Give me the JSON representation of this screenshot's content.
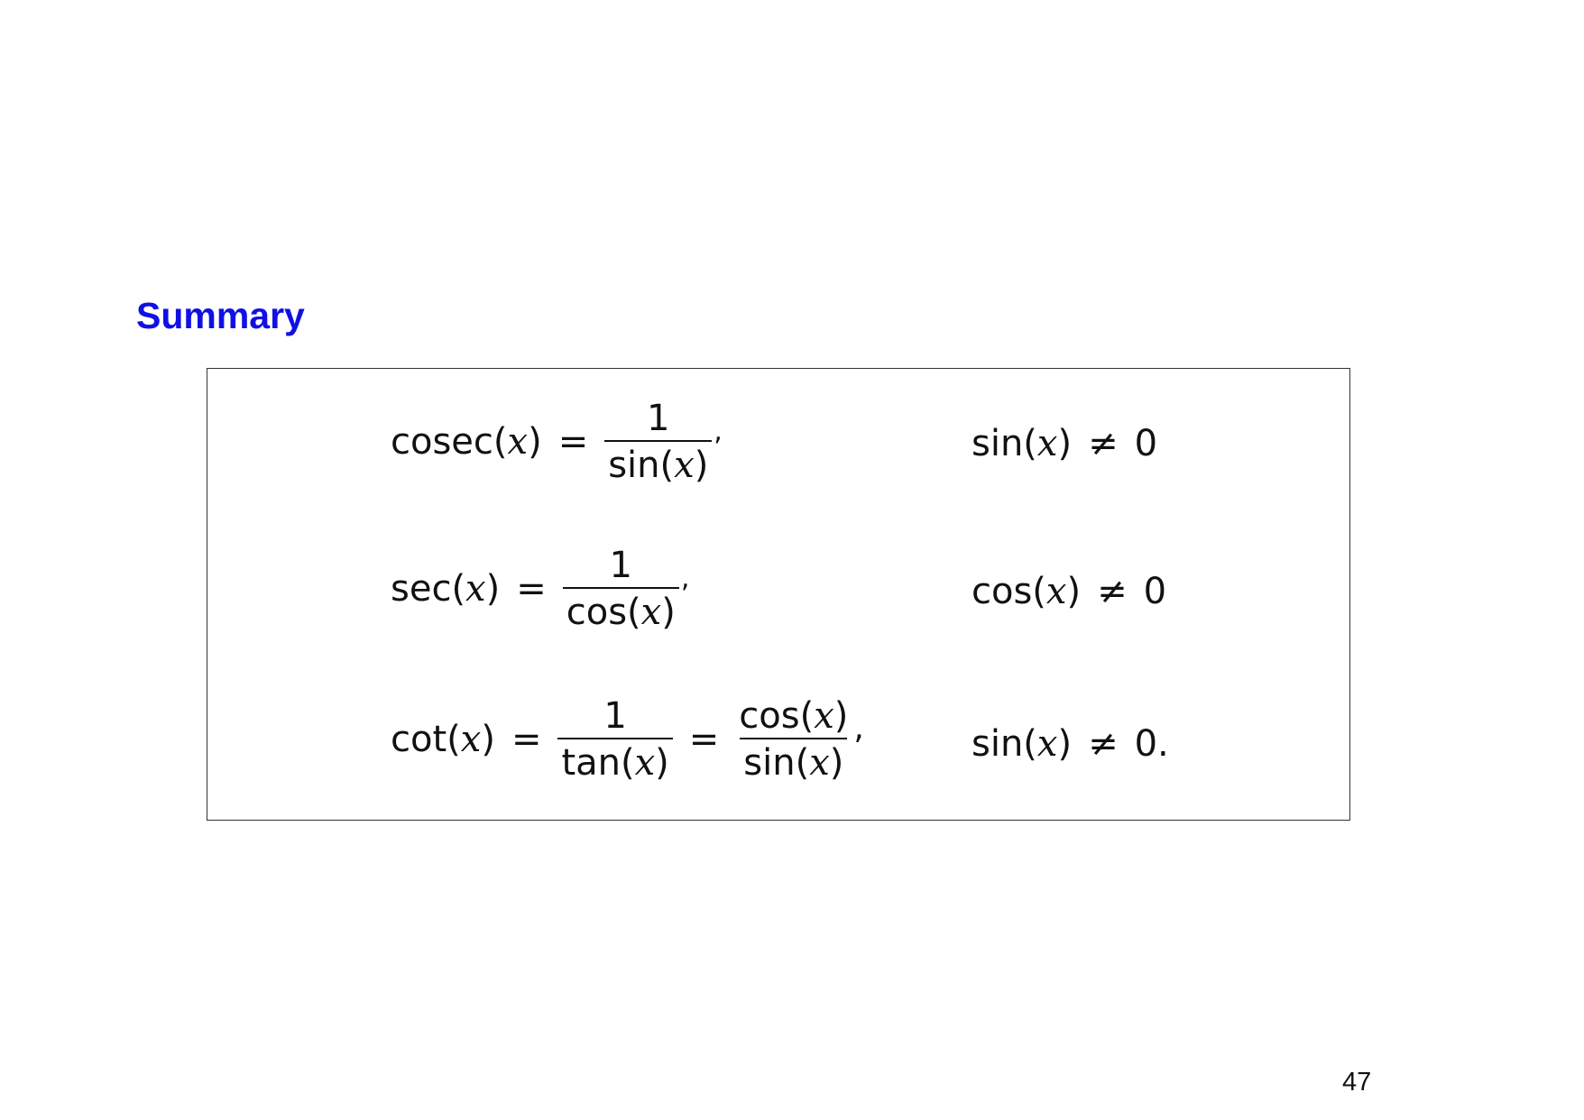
{
  "slide": {
    "title": "Summary",
    "title_color": "#1010e6",
    "page_number": "47"
  },
  "formulas": {
    "cosec": {
      "lhs": "cosec(",
      "var": "x",
      "close": ")",
      "equals": "=",
      "numerator": "1",
      "den_fn": "sin(",
      "den_var": "x",
      "den_close": ")",
      "comma": ",",
      "condition_fn": "sin(",
      "condition_var": "x",
      "condition_close": ")",
      "condition_op": "≠",
      "condition_value": "0"
    },
    "sec": {
      "lhs": "sec(",
      "var": "x",
      "close": ")",
      "equals": "=",
      "numerator": "1",
      "den_fn": "cos(",
      "den_var": "x",
      "den_close": ")",
      "comma": ",",
      "condition_fn": "cos(",
      "condition_var": "x",
      "condition_close": ")",
      "condition_op": "≠",
      "condition_value": "0"
    },
    "cot": {
      "lhs": "cot(",
      "var": "x",
      "close": ")",
      "equals": "=",
      "numerator": "1",
      "den_fn": "tan(",
      "den_var": "x",
      "den_close": ")",
      "equals2": "=",
      "num2_fn": "cos(",
      "num2_var": "x",
      "num2_close": ")",
      "den2_fn": "sin(",
      "den2_var": "x",
      "den2_close": ")",
      "comma": ",",
      "condition_fn": "sin(",
      "condition_var": "x",
      "condition_close": ")",
      "condition_op": "≠",
      "condition_value": "0."
    }
  }
}
